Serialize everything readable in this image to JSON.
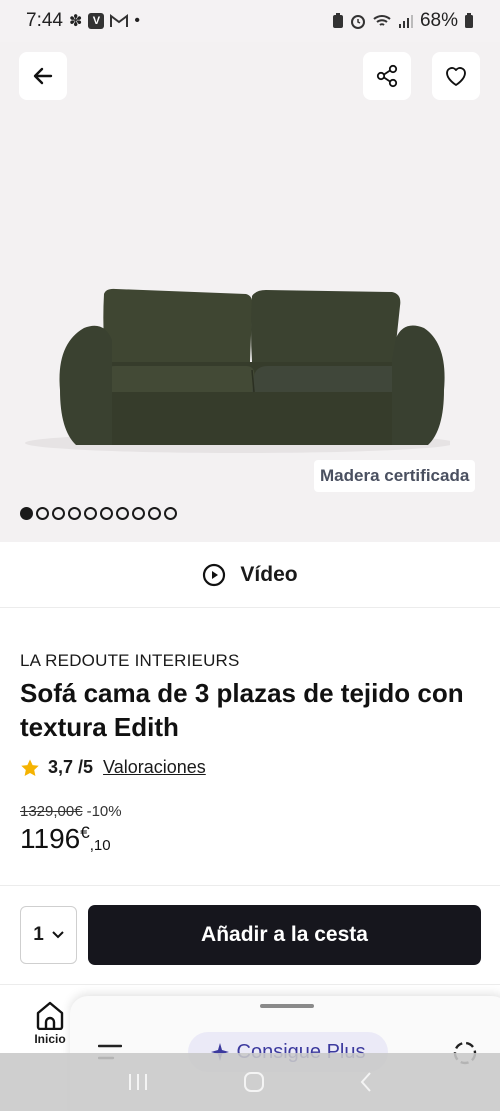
{
  "status_bar": {
    "time": "7:44",
    "battery": "68%"
  },
  "hero": {
    "badge": "Madera certificada",
    "dots_total": 10,
    "active_dot": 0
  },
  "video": {
    "label": "Vídeo"
  },
  "product": {
    "brand": "LA REDOUTE INTERIEURS",
    "title": "Sofá cama de 3 plazas de tejido con textura Edith",
    "rating": "3,7 /5",
    "reviews_link": "Valoraciones",
    "old_price": "1329,00€",
    "discount": "-10%",
    "price_int": "1196",
    "price_currency": "€",
    "price_dec": ",10"
  },
  "cart": {
    "quantity": "1",
    "add_label": "Añadir a la cesta"
  },
  "bottom_nav": {
    "home_label": "Inicio"
  },
  "sheet": {
    "plus_label": "Consigue Plus"
  },
  "colors": {
    "hero_bg": "#f3f1f2",
    "button_dark": "#16161d",
    "sofa_green": "#3d4430",
    "plus_accent": "#3c3a9e",
    "star": "#f5b301"
  }
}
